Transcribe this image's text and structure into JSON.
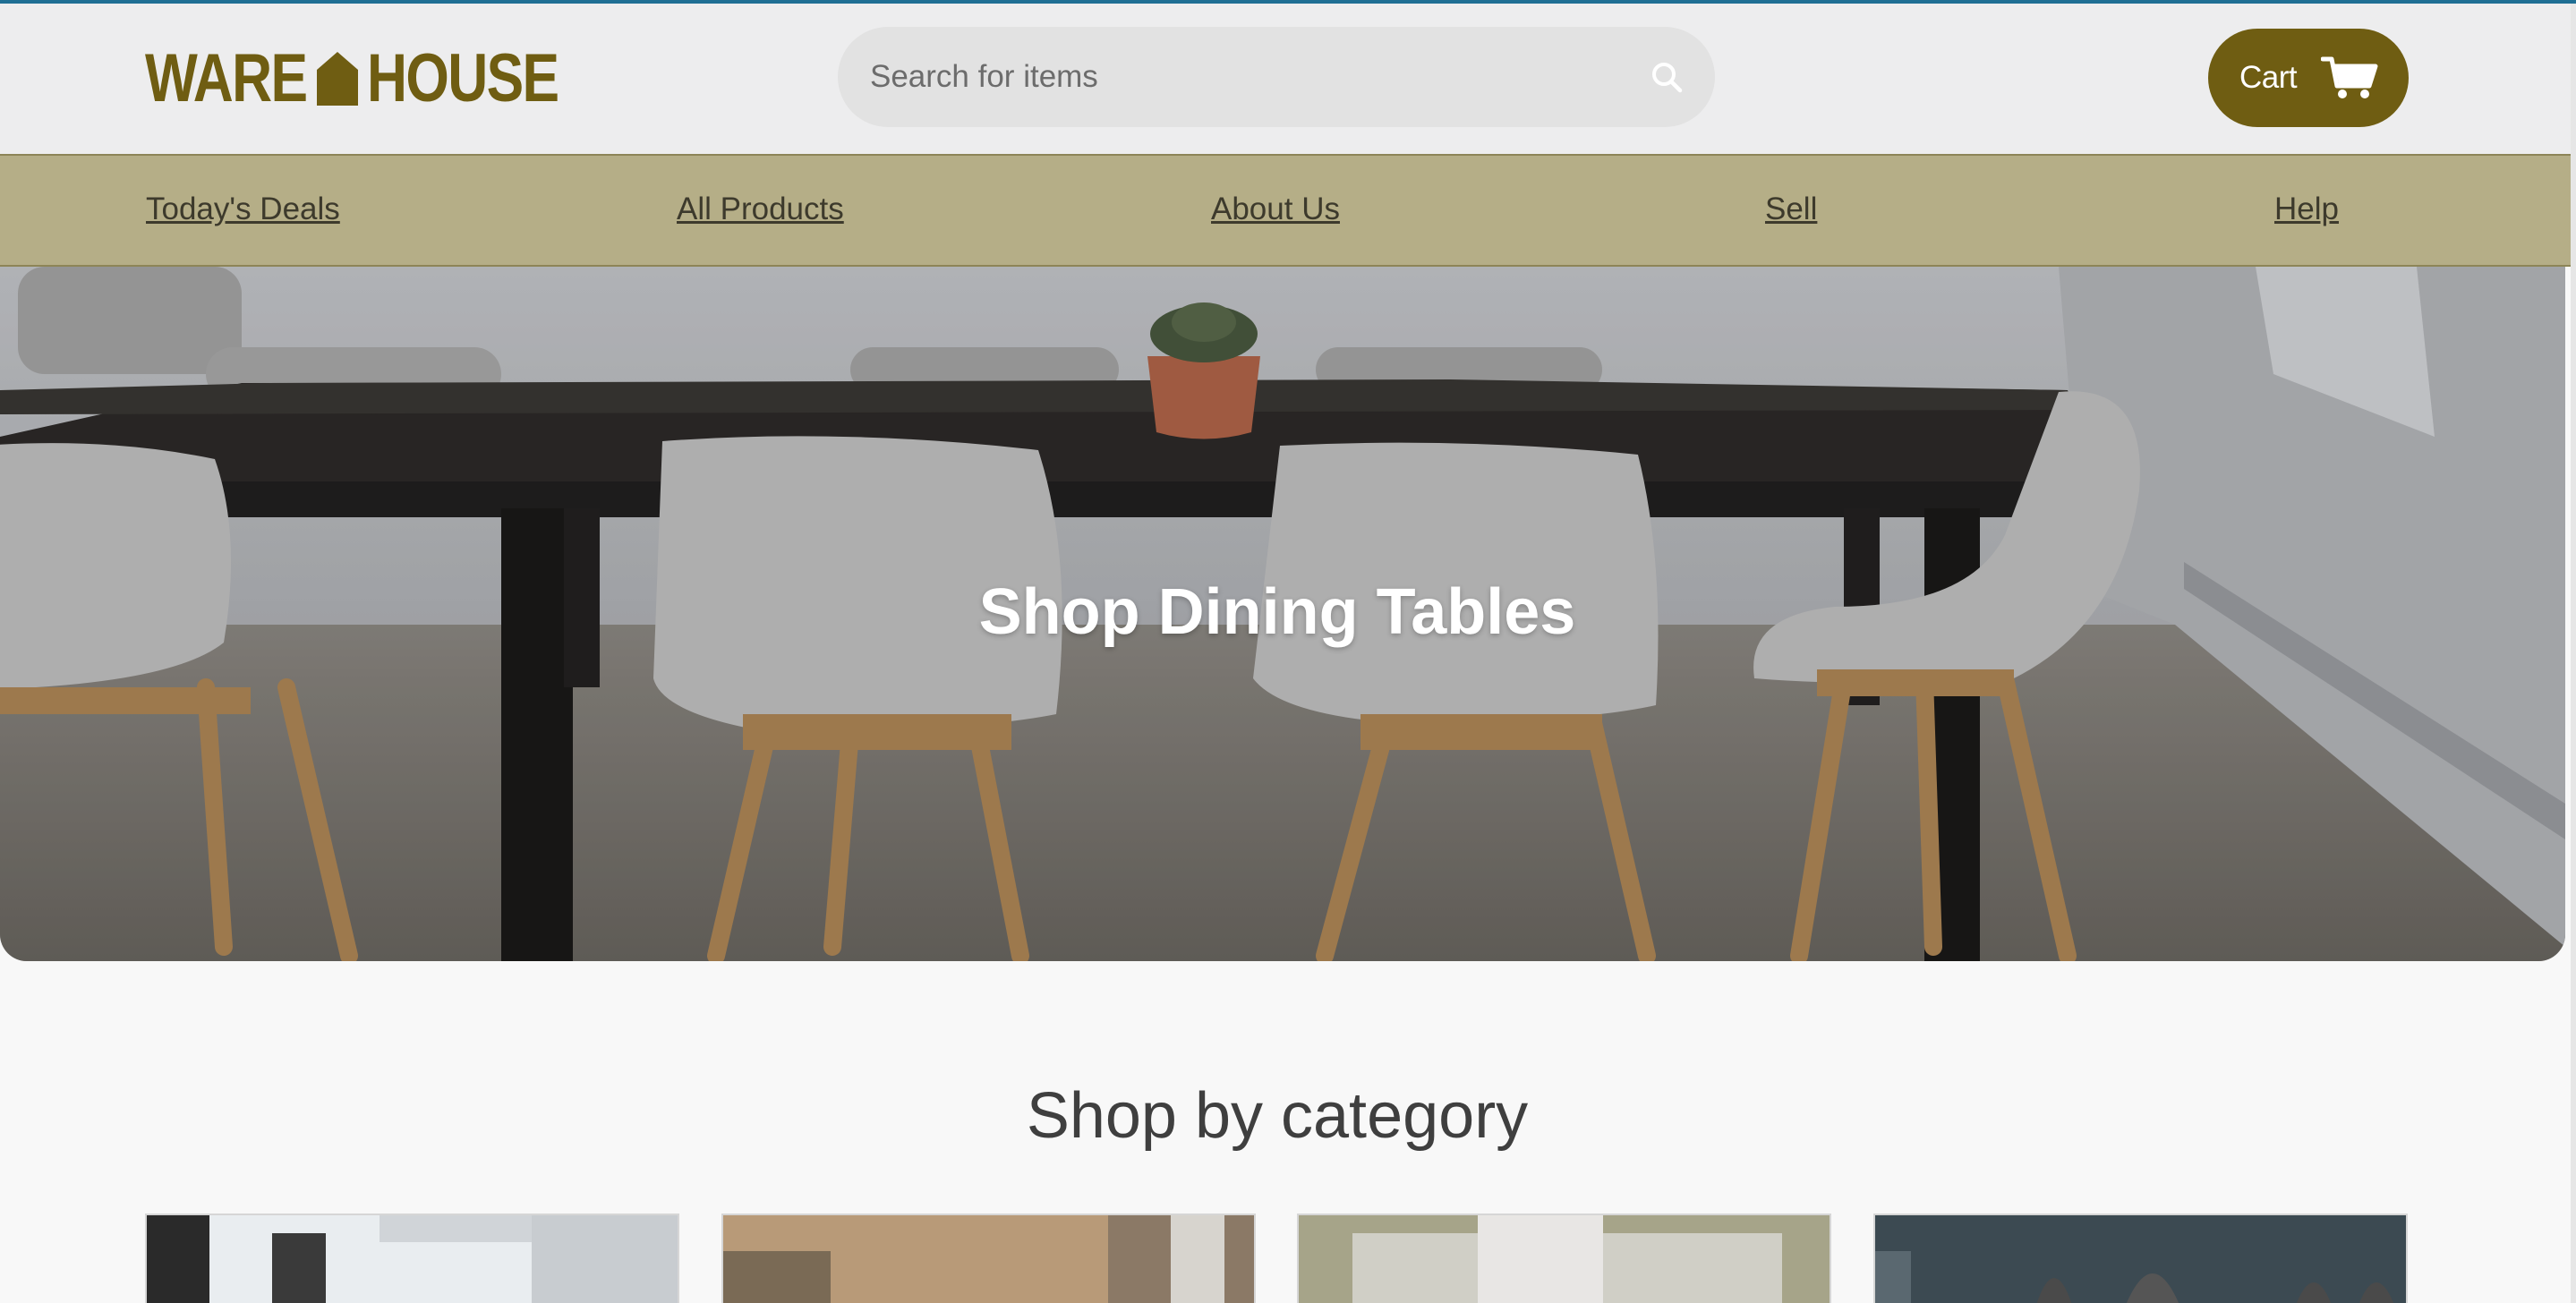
{
  "header": {
    "logo_text_left": "WARE",
    "logo_text_right": "HOUSE",
    "search_placeholder": "Search for items",
    "cart_label": "Cart"
  },
  "nav": {
    "items": [
      "Today's Deals",
      "All Products",
      "About Us",
      "Sell",
      "Help"
    ]
  },
  "hero": {
    "title": "Shop Dining Tables"
  },
  "categories": {
    "title": "Shop by category"
  },
  "colors": {
    "brand": "#6f5d12",
    "nav_bg": "#b5ae87",
    "header_bg": "#ededee",
    "top_accent": "#1f6f94"
  },
  "icons": [
    "search-icon",
    "cart-icon",
    "house-icon"
  ]
}
